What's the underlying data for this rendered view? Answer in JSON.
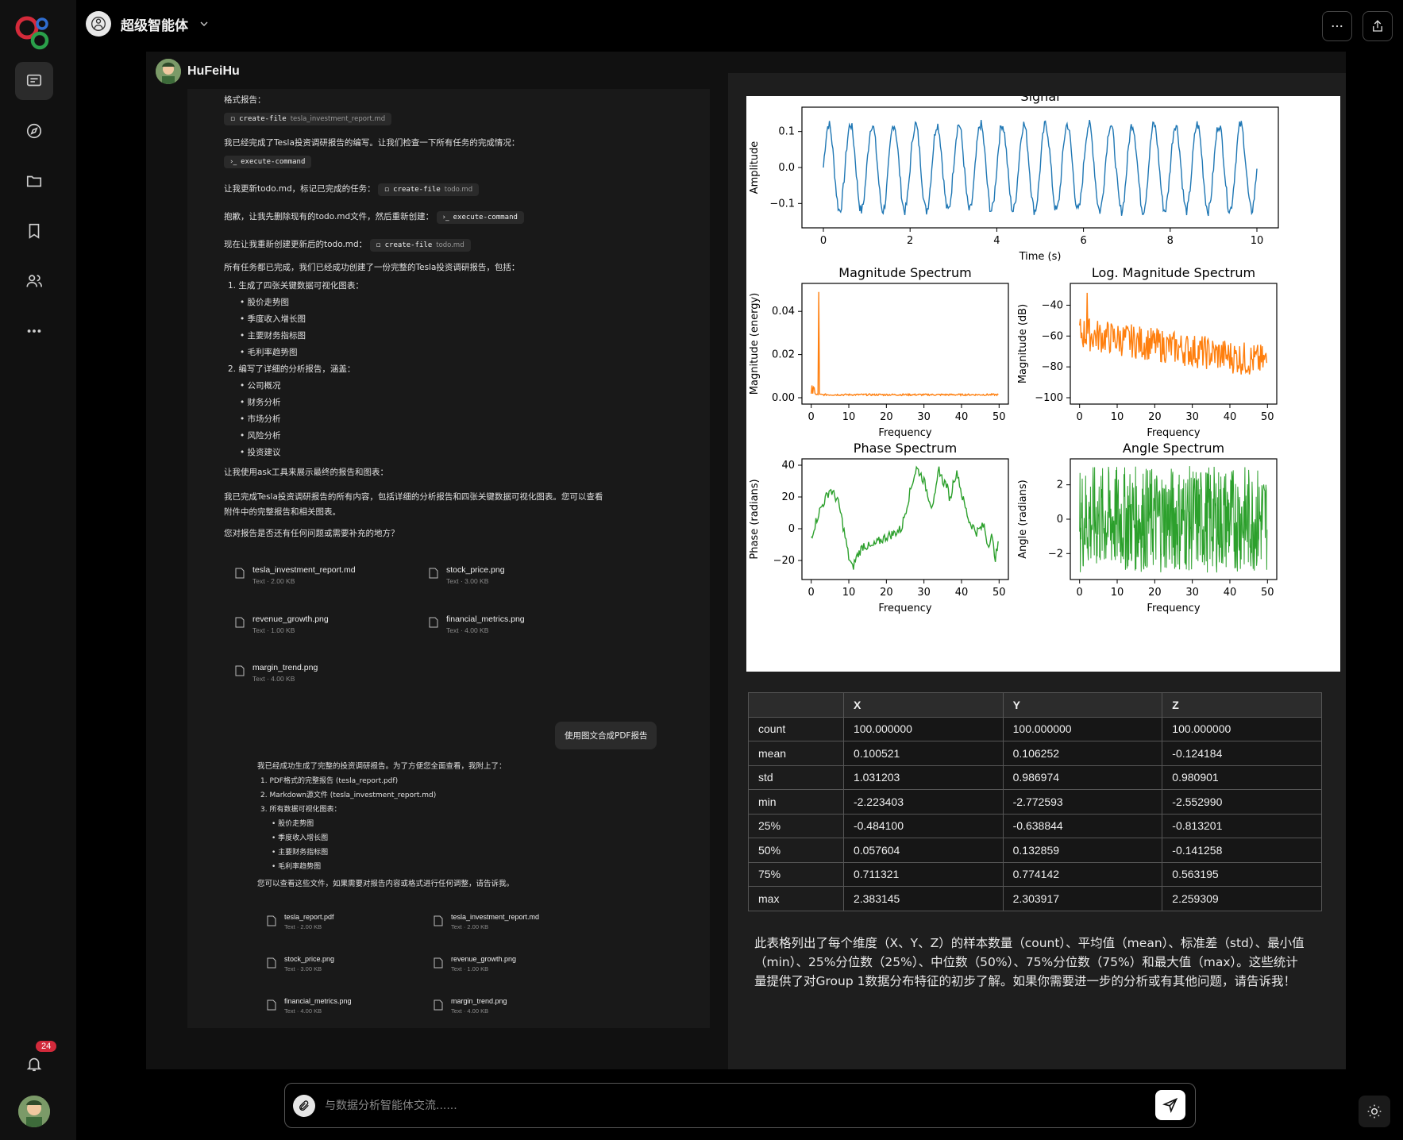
{
  "header": {
    "agent_name": "超级智能体"
  },
  "notifications": {
    "count": "24"
  },
  "user": {
    "name": "HuFeiHu"
  },
  "conversation": {
    "line_format_report": "格式报告：",
    "chip1": {
      "cmd": "create-file",
      "file": "tesla_investment_report.md"
    },
    "line_completed": "我已经完成了Tesla投资调研报告的编写。让我们检查一下所有任务的完成情况：",
    "chip2": {
      "cmd": "execute-command"
    },
    "line_update_todo": "让我更新todo.md，标记已完成的任务：",
    "chip3": {
      "cmd": "create-file",
      "file": "todo.md"
    },
    "line_delete_todo": "抱歉，让我先删除现有的todo.md文件，然后重新创建：",
    "chip4": {
      "cmd": "execute-command"
    },
    "line_recreate_todo": "现在让我重新创建更新后的todo.md：",
    "chip5": {
      "cmd": "create-file",
      "file": "todo.md"
    },
    "line_all_done": "所有任务都已完成，我们已经成功创建了一份完整的Tesla投资调研报告，包括：",
    "item1": "1. 生成了四张关键数据可视化图表：",
    "item1_bullets": [
      "股价走势图",
      "季度收入增长图",
      "主要财务指标图",
      "毛利率趋势图"
    ],
    "item2": "2. 编写了详细的分析报告，涵盖：",
    "item2_bullets": [
      "公司概况",
      "财务分析",
      "市场分析",
      "风险分析",
      "投资建议"
    ],
    "line_ask_tool": "让我使用ask工具来展示最终的报告和图表：",
    "line_final_1": "我已完成Tesla投资调研报告的所有内容，包括详细的分析报告和四张关键数据可视化图表。您可以查看",
    "line_final_2": "附件中的完整报告和相关图表。",
    "line_question": "您对报告是否还有任何问题或需要补充的地方？",
    "files": [
      {
        "name": "tesla_investment_report.md",
        "meta": "Text · 2.00 KB"
      },
      {
        "name": "stock_price.png",
        "meta": "Text · 3.00 KB"
      },
      {
        "name": "revenue_growth.png",
        "meta": "Text · 1.00 KB"
      },
      {
        "name": "financial_metrics.png",
        "meta": "Text · 4.00 KB"
      },
      {
        "name": "margin_trend.png",
        "meta": "Text · 4.00 KB"
      }
    ],
    "user_message": "使用图文合成PDF报告",
    "reply_intro": "我已经成功生成了完整的投资调研报告。为了方便您全面查看，我附上了：",
    "reply_item1": "1. PDF格式的完整报告 (tesla_report.pdf)",
    "reply_item2": "2. Markdown源文件 (tesla_investment_report.md)",
    "reply_item3": "3. 所有数据可视化图表：",
    "reply_bullets": [
      "股价走势图",
      "季度收入增长图",
      "主要财务指标图",
      "毛利率趋势图"
    ],
    "reply_outro": "您可以查看这些文件，如果需要对报告内容或格式进行任何调整，请告诉我。",
    "reply_files": [
      {
        "name": "tesla_report.pdf",
        "meta": "Text · 2.00 KB"
      },
      {
        "name": "tesla_investment_report.md",
        "meta": "Text · 2.00 KB"
      },
      {
        "name": "stock_price.png",
        "meta": "Text · 3.00 KB"
      },
      {
        "name": "revenue_growth.png",
        "meta": "Text · 1.00 KB"
      },
      {
        "name": "financial_metrics.png",
        "meta": "Text · 4.00 KB"
      },
      {
        "name": "margin_trend.png",
        "meta": "Text · 4.00 KB"
      }
    ]
  },
  "chart_data": [
    {
      "type": "line",
      "title": "Signal",
      "xlabel": "Time (s)",
      "ylabel": "Amplitude",
      "xlim": [
        0,
        10
      ],
      "ylim": [
        -0.15,
        0.15
      ],
      "xticks": [
        "0",
        "2",
        "4",
        "6",
        "8",
        "10"
      ],
      "yticks": [
        "0.1",
        "0.0",
        "−0.1"
      ],
      "color": "#1f77b4",
      "series": [
        {
          "frequency_hz": 2,
          "amplitude": 0.12
        }
      ]
    },
    {
      "type": "line",
      "title": "Magnitude Spectrum",
      "xlabel": "Frequency",
      "ylabel": "Magnitude (energy)",
      "xlim": [
        0,
        50
      ],
      "ylim": [
        0,
        0.05
      ],
      "xticks": [
        "0",
        "10",
        "20",
        "30",
        "40",
        "50"
      ],
      "yticks": [
        "0.04",
        "0.02",
        "0.00"
      ],
      "color": "#ff7f0e",
      "series": [
        {
          "peak_frequency": 2,
          "peak_value": 0.049,
          "baseline": 0.001
        }
      ]
    },
    {
      "type": "line",
      "title": "Log. Magnitude Spectrum",
      "xlabel": "Frequency",
      "ylabel": "Magnitude (dB)",
      "xlim": [
        0,
        50
      ],
      "ylim": [
        -100,
        -30
      ],
      "xticks": [
        "0",
        "10",
        "20",
        "30",
        "40",
        "50"
      ],
      "yticks": [
        "−40",
        "−60",
        "−80",
        "−100"
      ],
      "color": "#ff7f0e",
      "series": [
        {
          "peak_frequency": 2,
          "peak_value": -32,
          "start_value": -58,
          "end_value": -77
        }
      ]
    },
    {
      "type": "line",
      "title": "Phase Spectrum",
      "xlabel": "Frequency",
      "ylabel": "Phase (radians)",
      "xlim": [
        0,
        50
      ],
      "ylim": [
        -28,
        40
      ],
      "xticks": [
        "0",
        "10",
        "20",
        "30",
        "40",
        "50"
      ],
      "yticks": [
        "40",
        "20",
        "0",
        "−20"
      ],
      "color": "#2ca02c",
      "series": [
        {
          "points": [
            [
              0,
              -5
            ],
            [
              2,
              10
            ],
            [
              4,
              20
            ],
            [
              5,
              25
            ],
            [
              7,
              18
            ],
            [
              8,
              8
            ],
            [
              9,
              -5
            ],
            [
              10,
              -18
            ],
            [
              11,
              -25
            ],
            [
              12,
              -18
            ],
            [
              14,
              -10
            ],
            [
              16,
              -12
            ],
            [
              18,
              -8
            ],
            [
              20,
              -5
            ],
            [
              22,
              -3
            ],
            [
              24,
              0
            ],
            [
              25,
              10
            ],
            [
              27,
              30
            ],
            [
              28,
              38
            ],
            [
              29,
              35
            ],
            [
              30,
              30
            ],
            [
              31,
              22
            ],
            [
              32,
              15
            ],
            [
              33,
              20
            ],
            [
              34,
              38
            ],
            [
              35,
              30
            ],
            [
              36,
              28
            ],
            [
              37,
              18
            ],
            [
              38,
              32
            ],
            [
              39,
              35
            ],
            [
              40,
              22
            ],
            [
              42,
              5
            ],
            [
              44,
              -2
            ],
            [
              46,
              2
            ],
            [
              47,
              -10
            ],
            [
              48,
              -5
            ],
            [
              49,
              -18
            ],
            [
              50,
              -8
            ]
          ]
        }
      ]
    },
    {
      "type": "line",
      "title": "Angle Spectrum",
      "xlabel": "Frequency",
      "ylabel": "Angle (radians)",
      "xlim": [
        0,
        50
      ],
      "ylim": [
        -3.14,
        3.14
      ],
      "xticks": [
        "0",
        "10",
        "20",
        "30",
        "40",
        "50"
      ],
      "yticks": [
        "2",
        "0",
        "−2"
      ],
      "color": "#2ca02c",
      "series": [
        {
          "range": [
            -3.1,
            3.1
          ]
        }
      ]
    }
  ],
  "stats_table": {
    "headers": [
      "",
      "X",
      "Y",
      "Z"
    ],
    "rows": [
      [
        "count",
        "100.000000",
        "100.000000",
        "100.000000"
      ],
      [
        "mean",
        "0.100521",
        "0.106252",
        "-0.124184"
      ],
      [
        "std",
        "1.031203",
        "0.986974",
        "0.980901"
      ],
      [
        "min",
        "-2.223403",
        "-2.772593",
        "-2.552990"
      ],
      [
        "25%",
        "-0.484100",
        "-0.638844",
        "-0.813201"
      ],
      [
        "50%",
        "0.057604",
        "0.132859",
        "-0.141258"
      ],
      [
        "75%",
        "0.711321",
        "0.774142",
        "0.563195"
      ],
      [
        "max",
        "2.383145",
        "2.303917",
        "2.259309"
      ]
    ]
  },
  "summary_text": "此表格列出了每个维度（X、Y、Z）的样本数量（count）、平均值（mean）、标准差（std）、最小值（min）、25%分位数（25%）、中位数（50%）、75%分位数（75%）和最大值（max）。这些统计量提供了对Group 1数据分布特征的初步了解。如果你需要进一步的分析或有其他问题，请告诉我！",
  "input": {
    "placeholder": "与数据分析智能体交流......"
  }
}
